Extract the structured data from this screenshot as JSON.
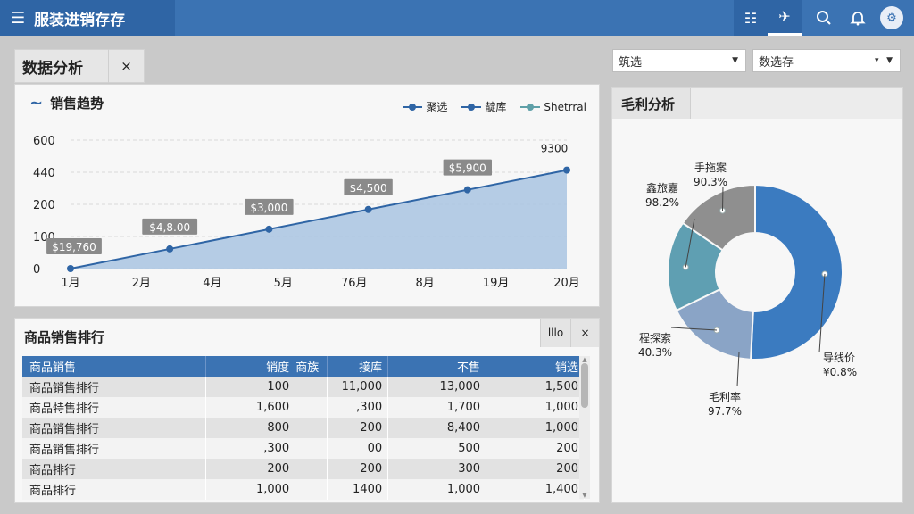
{
  "app": {
    "title": "服装进销存存"
  },
  "page_tab": {
    "title": "数据分析",
    "close": "×"
  },
  "filters": {
    "select1": "筑选",
    "select2": "数选存"
  },
  "trend": {
    "title": "销售趋势",
    "legend": [
      {
        "label": "聚选",
        "color": "#2f65a5"
      },
      {
        "label": "靛库",
        "color": "#2f65a5"
      },
      {
        "label": "Shetrral",
        "color": "#5fa0a8"
      }
    ]
  },
  "chart_data": [
    {
      "type": "area",
      "title": "销售趋势",
      "y_tick_labels": [
        "0",
        "100",
        "200",
        "440",
        "600"
      ],
      "x_tick_labels": [
        "1月",
        "2月",
        "4月",
        "5月",
        "76月",
        "8月",
        "19月",
        "20月"
      ],
      "point_labels": [
        "$19,760",
        "$4,8.00",
        "$3,000",
        "$4,500",
        "$5,900",
        "9300"
      ],
      "values": [
        0,
        100,
        200,
        300,
        400,
        500
      ],
      "ylim": [
        0,
        600
      ],
      "color": "#2f65a5",
      "fill": "#a9c4e2",
      "grid": true
    },
    {
      "type": "pie",
      "title": "毛利分析",
      "donut": true,
      "slices": [
        {
          "label": "导线价",
          "pct_text": "¥0.8%",
          "value": 50.8,
          "color": "#3b7bc0"
        },
        {
          "label": "程探索",
          "pct_text": "40.3%",
          "value": 17.0,
          "color": "#8aa4c6"
        },
        {
          "label": "鑫旅嘉",
          "pct_text": "98.2%",
          "value": 16.7,
          "color": "#5f9fb2"
        },
        {
          "label": "手拖案",
          "pct_text": "90.3%",
          "value": 15.5,
          "color": "#8f8f8f"
        }
      ],
      "extra_label": {
        "label": "毛利率",
        "pct_text": "97.7%"
      }
    }
  ],
  "rank": {
    "title": "商品销售排行",
    "tool_label": "lllo",
    "close": "×",
    "columns": [
      "商品销售",
      "销度",
      "商族",
      "接库",
      "不售",
      "销选"
    ],
    "rows": [
      [
        "商品销售排行",
        "100",
        "",
        "11,000",
        "13,000",
        "1,500"
      ],
      [
        "商品特售排行",
        "1,600",
        "",
        ",300",
        "1,700",
        "1,000"
      ],
      [
        "商品销售排行",
        "800",
        "",
        "200",
        "8,400",
        "1,000"
      ],
      [
        "商品销售排行",
        ",300",
        "",
        "00",
        "500",
        "200"
      ],
      [
        "商品排行",
        "200",
        "",
        "200",
        "300",
        "200"
      ],
      [
        "商品排行",
        "1,000",
        "",
        "1400",
        "1,000",
        "1,400"
      ]
    ]
  },
  "margin": {
    "title": "毛利分析"
  }
}
